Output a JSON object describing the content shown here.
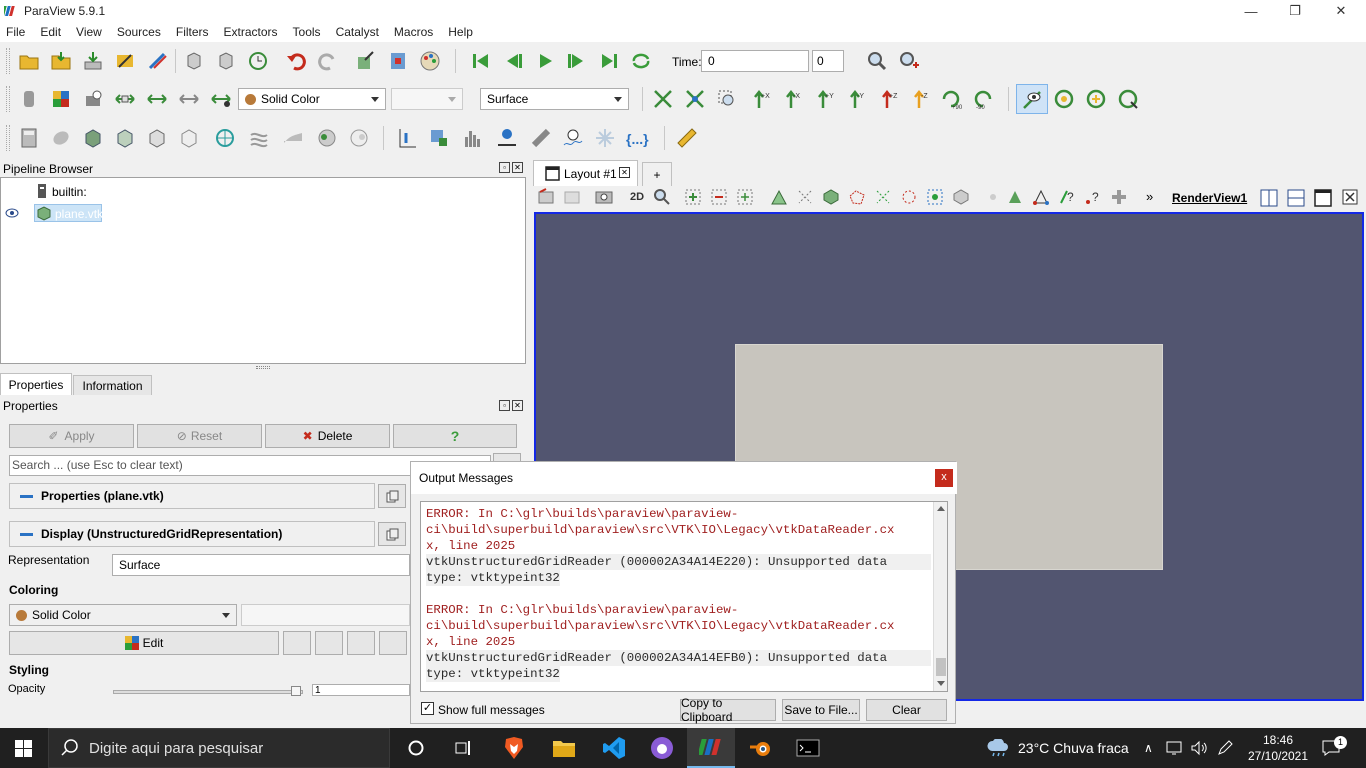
{
  "window": {
    "title": "ParaView 5.9.1",
    "minimize": "—",
    "restore": "❐",
    "close": "✕"
  },
  "menu": [
    "File",
    "Edit",
    "View",
    "Sources",
    "Filters",
    "Extractors",
    "Tools",
    "Catalyst",
    "Macros",
    "Help"
  ],
  "time": {
    "label": "Time:",
    "value": "0",
    "step": "0"
  },
  "toolbar2": {
    "color_by": "Solid Color",
    "representation": "Surface"
  },
  "pipeline": {
    "title": "Pipeline Browser",
    "root": "builtin:",
    "item": "plane.vtk"
  },
  "tabs": {
    "properties": "Properties",
    "information": "Information"
  },
  "properties": {
    "title": "Properties",
    "apply": "Apply",
    "reset": "Reset",
    "delete": "Delete",
    "help": "?",
    "search_placeholder": "Search ... (use Esc to clear text)",
    "section_properties": "Properties (plane.vtk)",
    "section_display": "Display (UnstructuredGridRepresentation)",
    "representation_label": "Representation",
    "representation_value": "Surface",
    "coloring_label": "Coloring",
    "coloring_value": "Solid Color",
    "edit": "Edit",
    "styling_label": "Styling",
    "opacity_label": "Opacity",
    "opacity_value": "1"
  },
  "layout": {
    "tab": "Layout #1",
    "add": "+",
    "view_name": "RenderView1",
    "mode_2d": "2D",
    "more": "»"
  },
  "output": {
    "title": "Output Messages",
    "close": "x",
    "messages": [
      {
        "err1": "ERROR: In C:\\glr\\builds\\paraview\\paraview-",
        "err2": "ci\\build\\superbuild\\paraview\\src\\VTK\\IO\\Legacy\\vtkDataReader.cx",
        "err3": "x, line 2025",
        "hl": "vtkUnstructuredGridReader (000002A34A14E220): Unsupported data",
        "line5": "type: vtktypeint32"
      },
      {
        "err1": "ERROR: In C:\\glr\\builds\\paraview\\paraview-",
        "err2": "ci\\build\\superbuild\\paraview\\src\\VTK\\IO\\Legacy\\vtkDataReader.cx",
        "err3": "x, line 2025",
        "hl": "vtkUnstructuredGridReader (000002A34A14EFB0): Unsupported data",
        "line5": "type: vtktypeint32"
      }
    ],
    "show_full": "Show full messages",
    "copy": "Copy to Clipboard",
    "save": "Save to File...",
    "clear": "Clear"
  },
  "taskbar": {
    "search_placeholder": "Digite aqui para pesquisar",
    "weather": "23°C  Chuva fraca",
    "time": "18:46",
    "date": "27/10/2021",
    "notifications": "1"
  },
  "colors": {
    "render_bg": "#525570",
    "plane": "#c8c5be",
    "error_text": "#a02020",
    "accent": "#1428e6"
  }
}
